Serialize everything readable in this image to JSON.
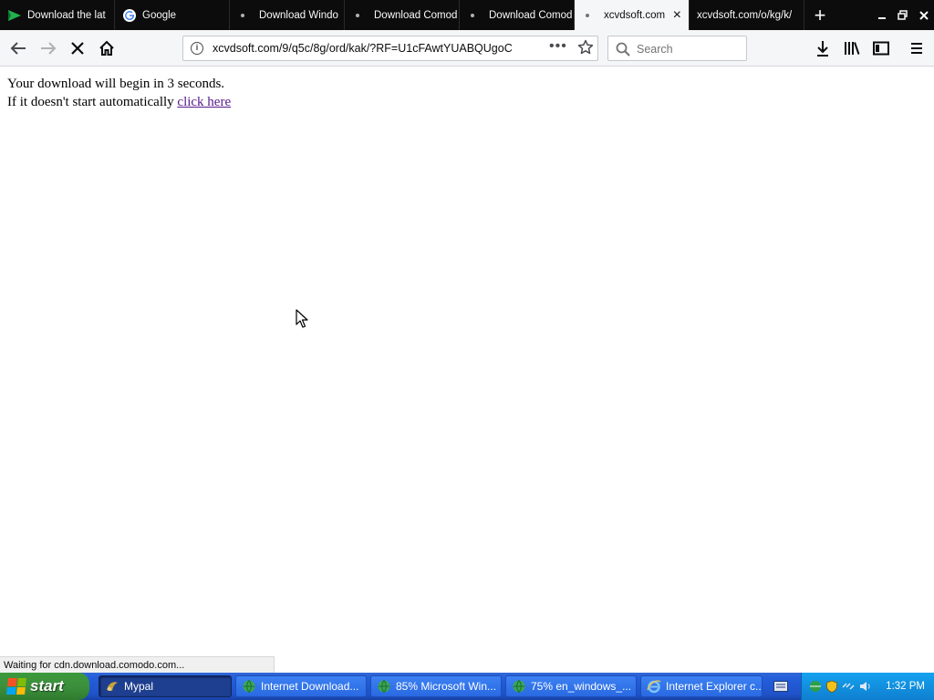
{
  "tabs": [
    {
      "title": "Download the lat",
      "icon": "green-flag-icon",
      "active": false
    },
    {
      "title": "Google",
      "icon": "google-icon",
      "active": false
    },
    {
      "title": "Download Windo",
      "icon": "dot",
      "active": false
    },
    {
      "title": "Download Comod",
      "icon": "dot",
      "active": false
    },
    {
      "title": "Download Comod",
      "icon": "dot",
      "active": false
    },
    {
      "title": "xcvdsoft.com",
      "icon": "dot",
      "active": true,
      "close": "×"
    },
    {
      "title": "xcvdsoft.com/o/kg/k/",
      "icon": "",
      "active": false
    }
  ],
  "new_tab": "+",
  "nav": {
    "url": "xcvdsoft.com/9/q5c/8g/ord/kak/?RF=U1cFAwtYUABQUgoC",
    "search_placeholder": "Search"
  },
  "page": {
    "line1": "Your download will begin in 3 seconds.",
    "line2_prefix": "If it doesn't start automatically ",
    "link": "click here"
  },
  "status_text": "Waiting for cdn.download.comodo.com...",
  "taskbar": {
    "start": "start",
    "items": [
      {
        "label": "Mypal",
        "pressed": true
      },
      {
        "label": "Internet Download...",
        "pressed": false
      },
      {
        "label": "85% Microsoft Win...",
        "pressed": false
      },
      {
        "label": "75% en_windows_...",
        "pressed": false
      },
      {
        "label": "Internet Explorer c...",
        "pressed": false
      }
    ],
    "clock": "1:32 PM"
  }
}
